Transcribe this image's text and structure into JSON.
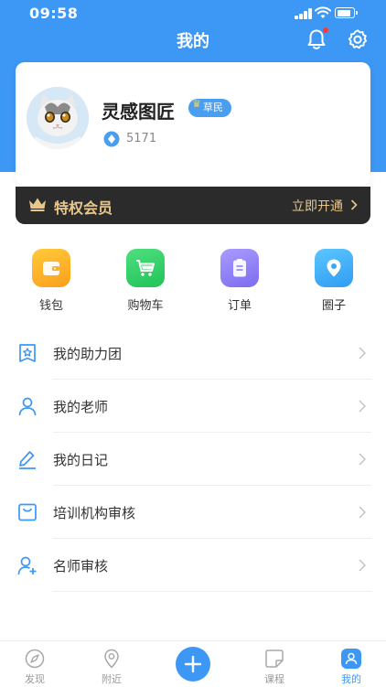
{
  "status_bar": {
    "time": "09:58"
  },
  "nav": {
    "title": "我的"
  },
  "profile": {
    "username": "灵感图匠",
    "level_badge": "草民",
    "coins": "5171"
  },
  "vip": {
    "label": "特权会员",
    "action": "立即开通"
  },
  "quick_actions": [
    {
      "label": "钱包",
      "icon": "wallet-icon"
    },
    {
      "label": "购物车",
      "icon": "cart-icon"
    },
    {
      "label": "订单",
      "icon": "order-icon"
    },
    {
      "label": "圈子",
      "icon": "circle-icon"
    }
  ],
  "menu": [
    {
      "label": "我的助力团",
      "icon": "star-badge-icon"
    },
    {
      "label": "我的老师",
      "icon": "person-icon"
    },
    {
      "label": "我的日记",
      "icon": "pencil-icon"
    },
    {
      "label": "培训机构审核",
      "icon": "bag-icon"
    },
    {
      "label": "名师审核",
      "icon": "person-add-icon"
    }
  ],
  "tab_bar": {
    "items": [
      {
        "label": "发现",
        "icon": "compass-icon"
      },
      {
        "label": "附近",
        "icon": "location-icon"
      },
      {
        "label": "课程",
        "icon": "course-icon"
      },
      {
        "label": "我的",
        "icon": "user-icon"
      }
    ],
    "active": "我的"
  },
  "colors": {
    "primary": "#3d97f4",
    "vip_gold": "#e8c88a",
    "vip_bg": "#2b2b2b",
    "wallet": "#fb9f1c",
    "cart": "#22c25a",
    "order": "#7d6cf0",
    "circle": "#2f9cf2"
  }
}
